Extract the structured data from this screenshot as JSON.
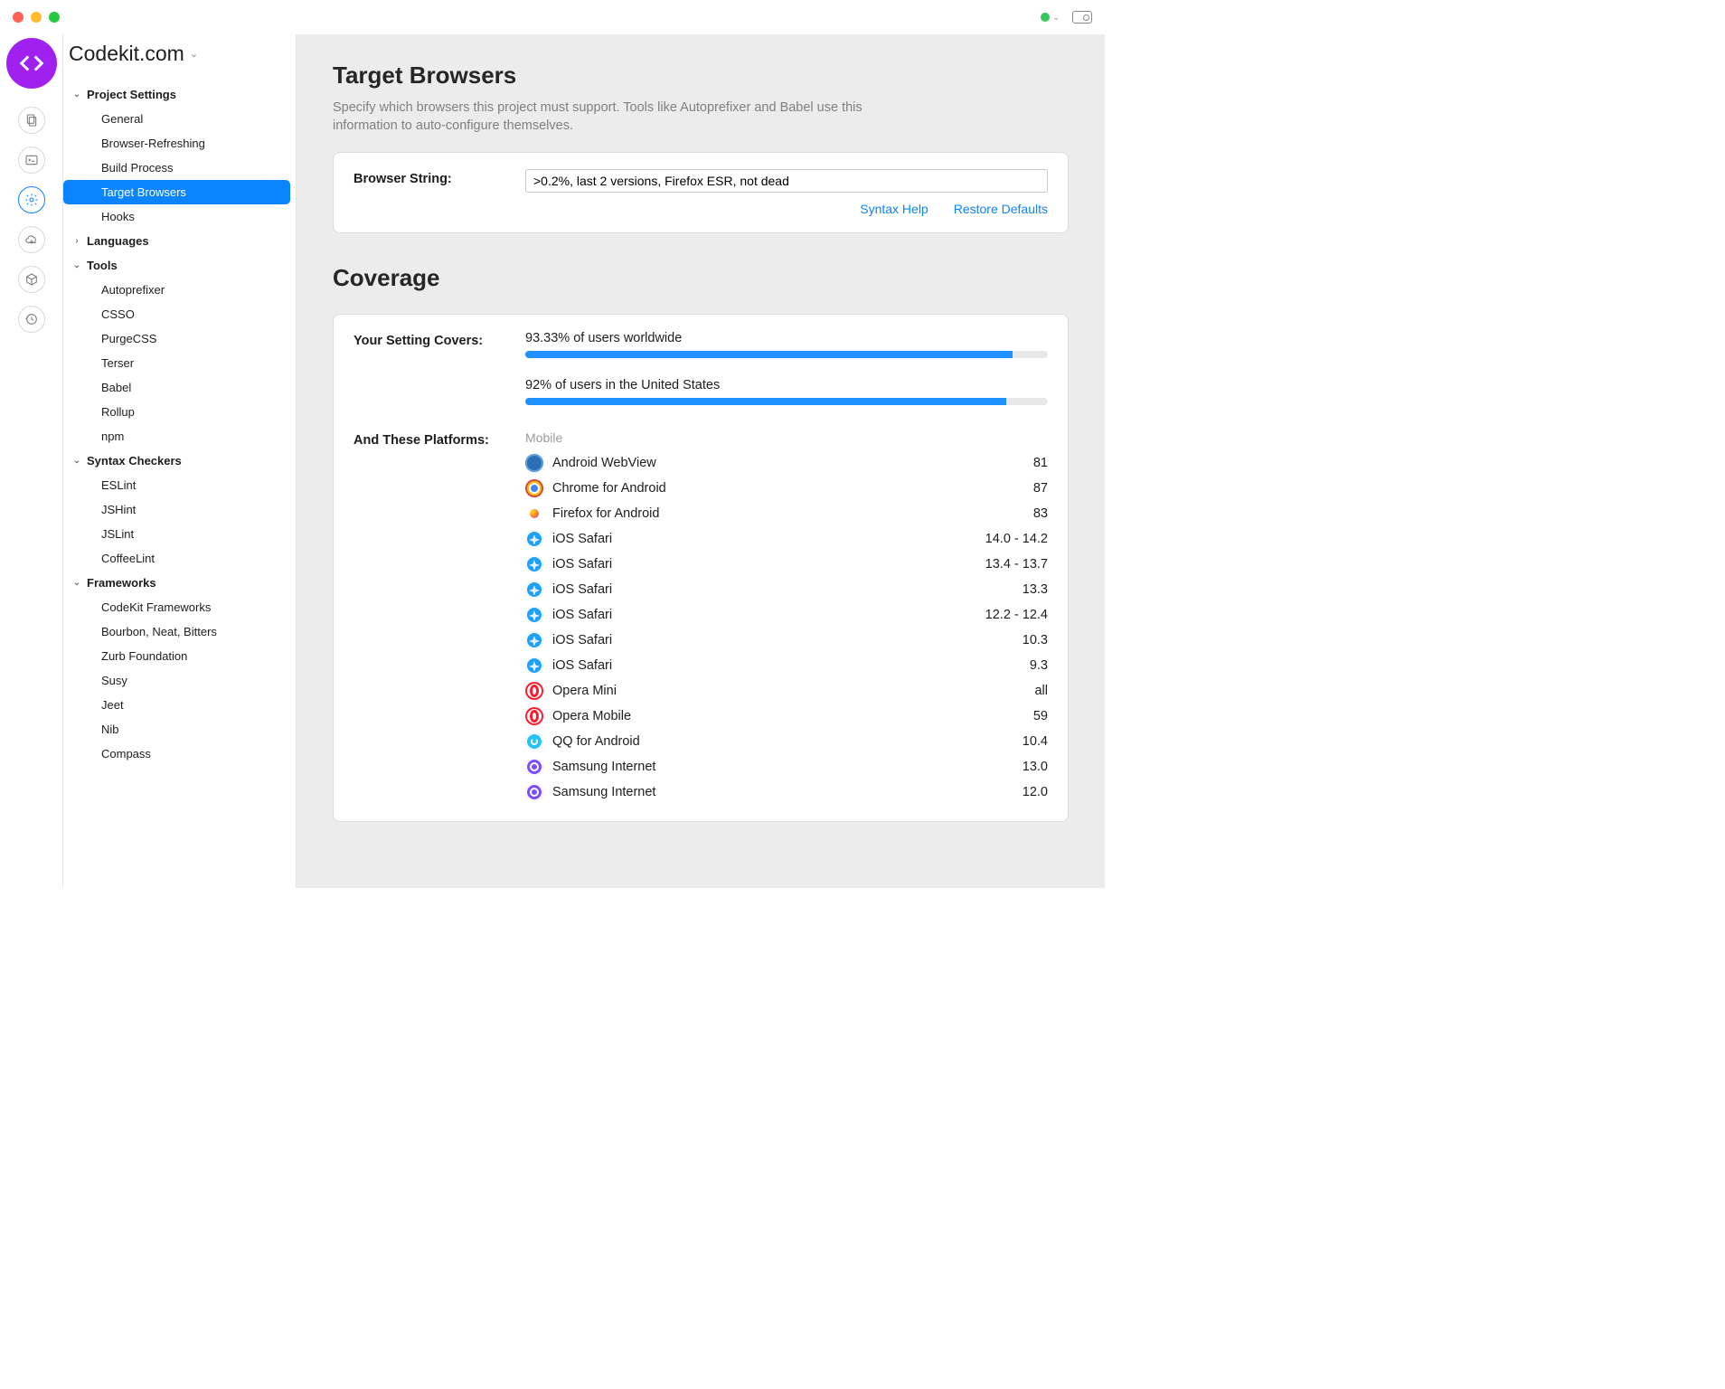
{
  "project_name": "Codekit.com",
  "sidebar": {
    "sections": [
      {
        "label": "Project Settings",
        "open": true,
        "items": [
          "General",
          "Browser-Refreshing",
          "Build Process",
          "Target Browsers",
          "Hooks"
        ],
        "selected": "Target Browsers"
      },
      {
        "label": "Languages",
        "open": false,
        "items": []
      },
      {
        "label": "Tools",
        "open": true,
        "items": [
          "Autoprefixer",
          "CSSO",
          "PurgeCSS",
          "Terser",
          "Babel",
          "Rollup",
          "npm"
        ]
      },
      {
        "label": "Syntax Checkers",
        "open": true,
        "items": [
          "ESLint",
          "JSHint",
          "JSLint",
          "CoffeeLint"
        ]
      },
      {
        "label": "Frameworks",
        "open": true,
        "items": [
          "CodeKit Frameworks",
          "Bourbon, Neat, Bitters",
          "Zurb Foundation",
          "Susy",
          "Jeet",
          "Nib",
          "Compass"
        ]
      }
    ]
  },
  "main": {
    "title": "Target Browsers",
    "subtitle": "Specify which browsers this project must support. Tools like Autoprefixer and Babel use this information to auto-configure themselves.",
    "browser_string_label": "Browser String:",
    "browser_string_value": ">0.2%, last 2 versions, Firefox ESR, not dead",
    "syntax_help": "Syntax Help",
    "restore_defaults": "Restore Defaults",
    "coverage_title": "Coverage",
    "covers_label": "Your Setting Covers:",
    "world": {
      "text": "93.33% of users worldwide",
      "pct": 93.33
    },
    "us": {
      "text": "92% of users in the United States",
      "pct": 92
    },
    "platforms_label": "And These Platforms:",
    "mobile_header": "Mobile",
    "platforms": [
      {
        "icon": "android-webview",
        "name": "Android WebView",
        "ver": "81"
      },
      {
        "icon": "chrome",
        "name": "Chrome for Android",
        "ver": "87"
      },
      {
        "icon": "firefox",
        "name": "Firefox for Android",
        "ver": "83"
      },
      {
        "icon": "safari",
        "name": "iOS Safari",
        "ver": "14.0 - 14.2"
      },
      {
        "icon": "safari",
        "name": "iOS Safari",
        "ver": "13.4 - 13.7"
      },
      {
        "icon": "safari",
        "name": "iOS Safari",
        "ver": "13.3"
      },
      {
        "icon": "safari",
        "name": "iOS Safari",
        "ver": "12.2 - 12.4"
      },
      {
        "icon": "safari",
        "name": "iOS Safari",
        "ver": "10.3"
      },
      {
        "icon": "safari",
        "name": "iOS Safari",
        "ver": "9.3"
      },
      {
        "icon": "opera",
        "name": "Opera Mini",
        "ver": "all"
      },
      {
        "icon": "opera",
        "name": "Opera Mobile",
        "ver": "59"
      },
      {
        "icon": "qq",
        "name": "QQ for Android",
        "ver": "10.4"
      },
      {
        "icon": "samsung",
        "name": "Samsung Internet",
        "ver": "13.0"
      },
      {
        "icon": "samsung",
        "name": "Samsung Internet",
        "ver": "12.0"
      }
    ]
  },
  "icon_colors": {
    "android-webview": {
      "bg": "#2a6fb5",
      "ring": "#5aa0e0"
    },
    "chrome": {
      "bg": "#fff",
      "ring": "#db4437"
    },
    "firefox": {
      "bg": "#ff7139",
      "ring": "#9059ff"
    },
    "safari": {
      "bg": "#1ea0ff",
      "ring": "#fff"
    },
    "opera": {
      "bg": "#fff",
      "ring": "#ff1b2d"
    },
    "qq": {
      "bg": "#22c3ff",
      "ring": "#fff"
    },
    "samsung": {
      "bg": "#7c4dff",
      "ring": "#fff"
    }
  }
}
